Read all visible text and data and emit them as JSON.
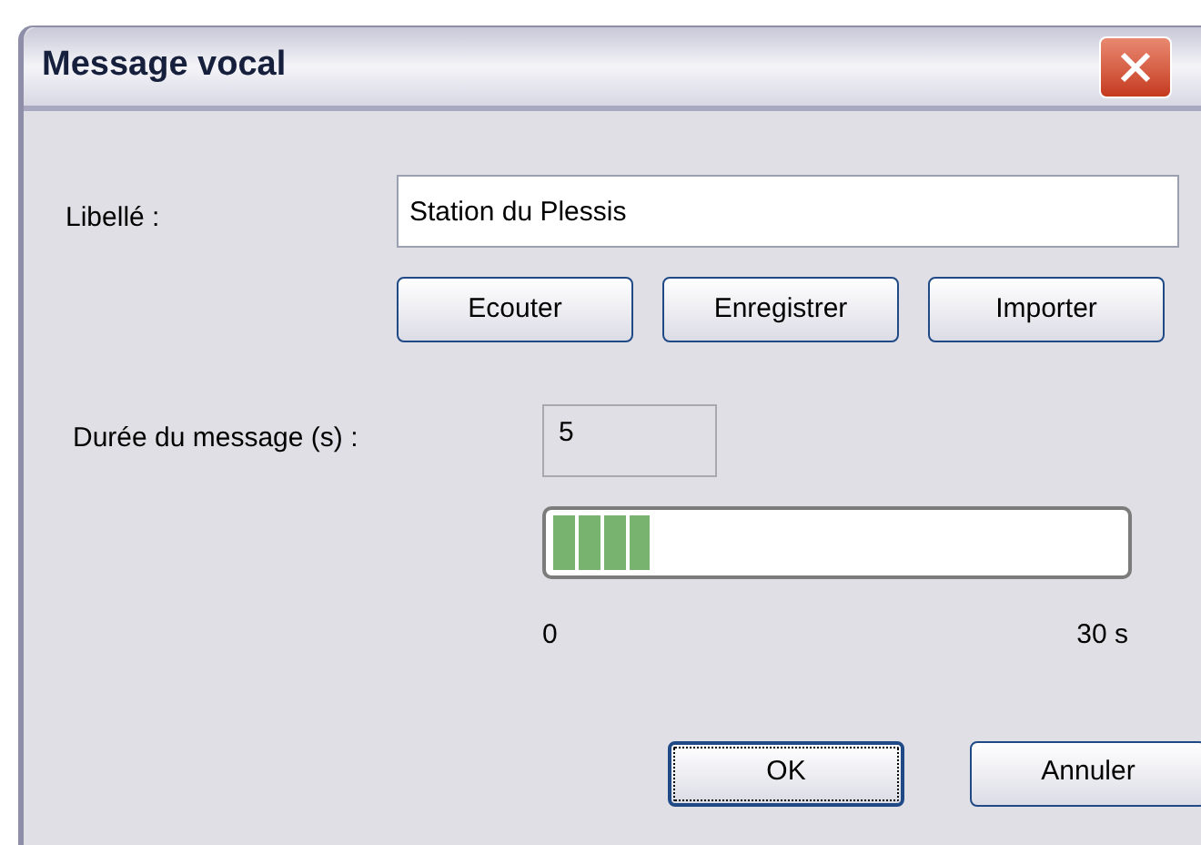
{
  "window": {
    "title": "Message vocal"
  },
  "label_field": {
    "label": "Libellé :",
    "value": "Station du Plessis"
  },
  "action_buttons": [
    "Ecouter",
    "Enregistrer",
    "Importer"
  ],
  "duration": {
    "label": "Durée du message (s) :",
    "value": "5"
  },
  "progress": {
    "level": 0.17,
    "min_label": "0",
    "max_label": "30 s"
  },
  "buttons": [
    {
      "label": "OK",
      "default": true
    },
    {
      "label": "Annuler",
      "default": false
    }
  ]
}
